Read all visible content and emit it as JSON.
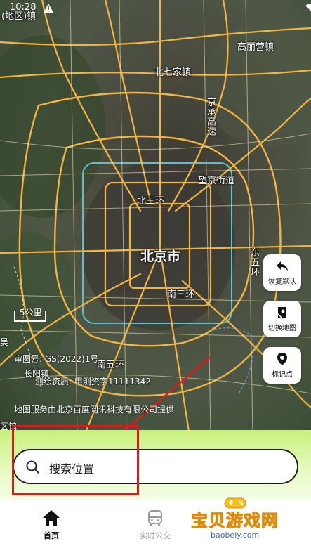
{
  "status_bar": {
    "time": "10:28",
    "icons": [
      "warning-icon",
      "wifi-icon",
      "battery-icon"
    ]
  },
  "map": {
    "labels": {
      "top_left": "(地区)镇",
      "gaoliying": "高丽营镇",
      "beiqijia": "北七家镇",
      "jingcheng": "京承高速",
      "wangjing": "望京街道",
      "beisanhuan": "北三环",
      "beijing": "北京市",
      "dongwuhuan": "东五环",
      "nansanhuan": "南三环",
      "nanwuhuan": "南五环",
      "changyang": "长阳镇",
      "left_edge": "吴",
      "bottom_left": "区镇"
    },
    "scale": "5公里",
    "credits": {
      "review_no": "审图号: GS(2022)1号",
      "surveying": "测绘资质: 甲测资字11111342",
      "provider": "地图服务由北京百度网讯科技有限公司提供"
    }
  },
  "tools": {
    "reset": "恢复默认",
    "switch_map": "切换地图",
    "mark": "标记点"
  },
  "search": {
    "placeholder": "搜索位置"
  },
  "nav": {
    "home": "首页",
    "bus": "实时公交"
  },
  "watermark": {
    "text": "宝贝游戏网",
    "url": "baobeiy.com"
  },
  "colors": {
    "accent_green": "#c8f07a",
    "annotation_red": "#e01818",
    "road_yellow": "#f2b544"
  }
}
